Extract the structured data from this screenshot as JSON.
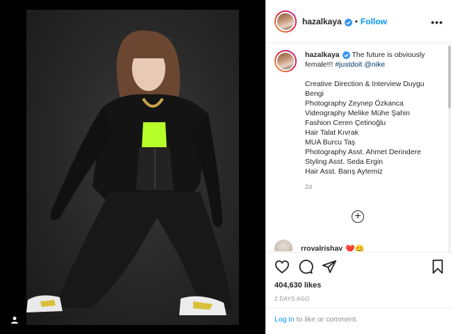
{
  "post": {
    "username": "hazalkaya",
    "follow_label": "Follow",
    "dot": "•",
    "more_label": "•••",
    "caption_body": "The future is obviously female!!!",
    "hashtag": "#justdoit",
    "mention": "@nike",
    "credits": [
      "Creative Direction & Interview Duygu",
      "Bengi",
      "Photography Zeynep Özkanca",
      "Videography Melike Mühe Şahin",
      "Fashion Ceren Çetinoğlu",
      "Hair Talat Kıvrak",
      "MUA Burcu Taş",
      "Photography Asst. Ahmet Derindere",
      "Styling Asst. Seda Ergin",
      "Hair Asst. Barış Aytemiz"
    ],
    "age": "2d",
    "load_more_symbol": "+",
    "comment_username": "rrovalrishav",
    "comment_emojis": "❤️😊",
    "likes": "404,630 likes",
    "date": "2 DAYS AGO",
    "login_link": "Log in",
    "login_suffix": " to like or comment."
  },
  "icons": {
    "verified": "verified-badge-icon",
    "like": "heart-icon",
    "comment": "comment-icon",
    "share": "share-icon",
    "save": "bookmark-icon",
    "user_tag": "user-tag-icon",
    "load_more": "plus-circle-icon"
  },
  "colors": {
    "accent": "#0095f6",
    "text": "#262626",
    "muted": "#8e8e8e",
    "verified": "#3897f0",
    "neon_top": "#b7ff2a"
  }
}
